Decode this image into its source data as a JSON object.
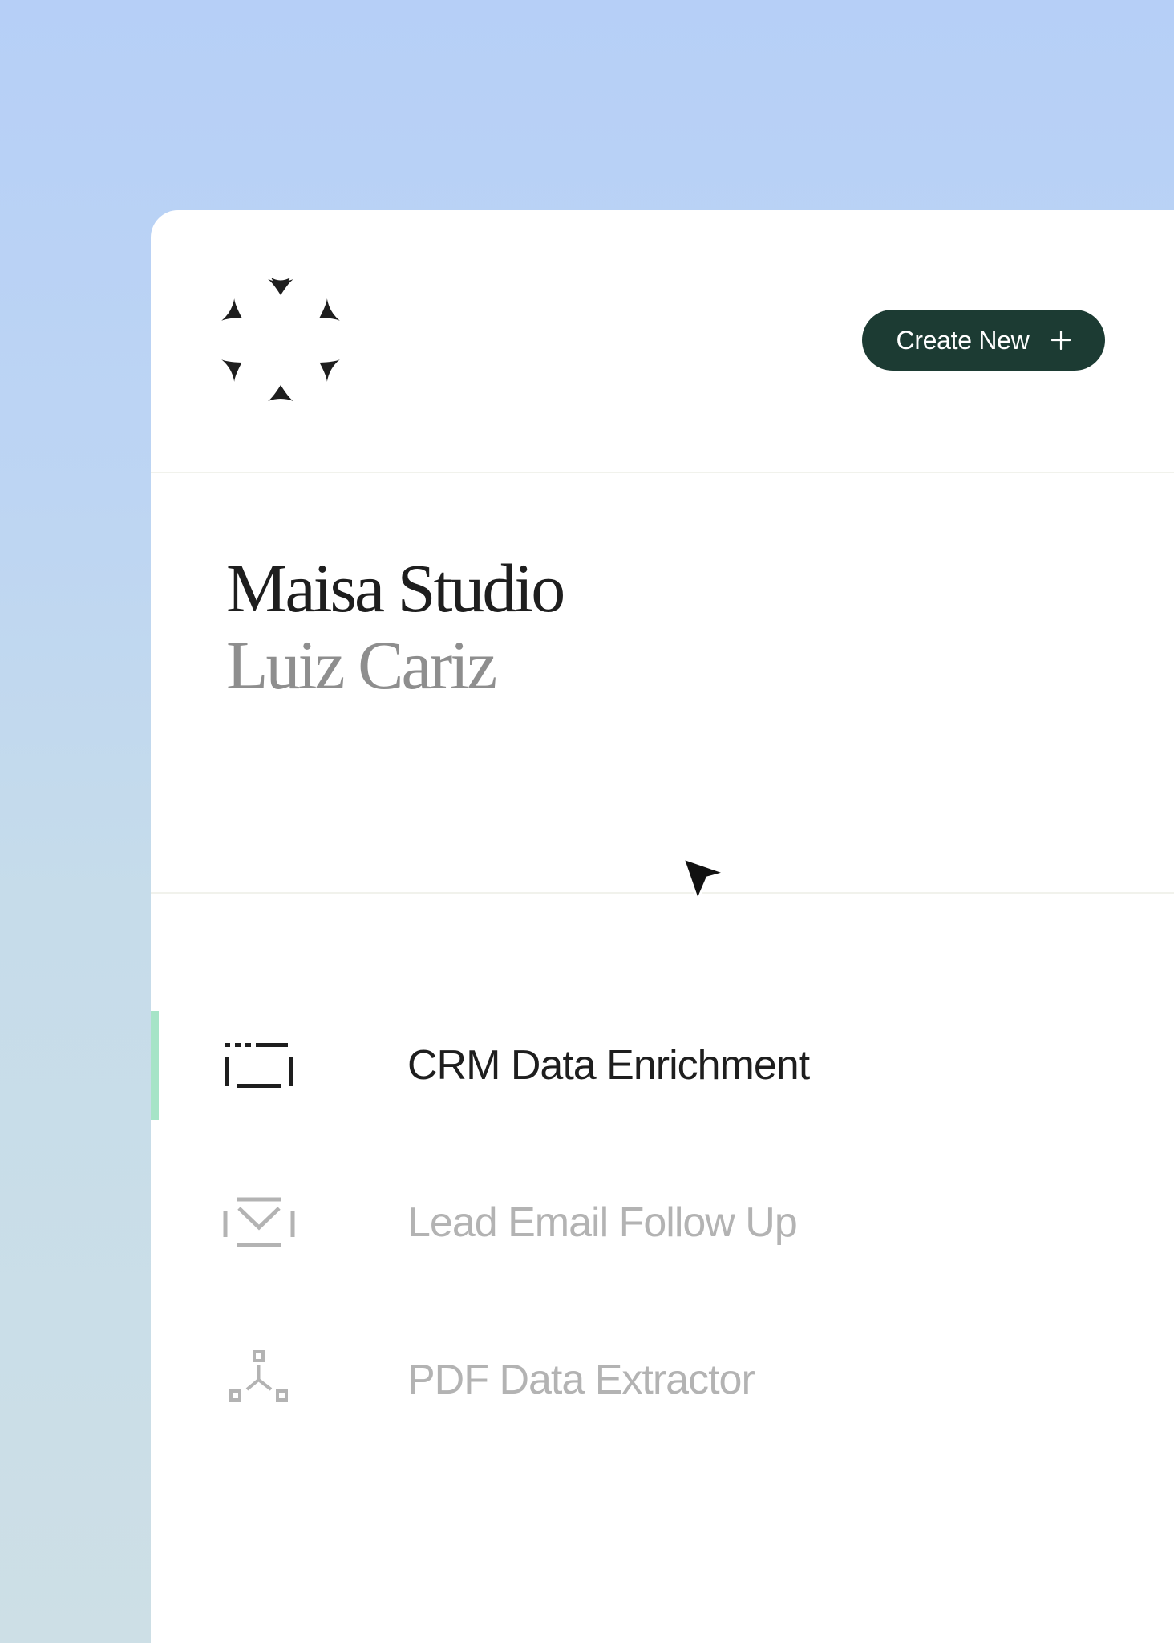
{
  "header": {
    "logo_icon": "asterisk-star-logo-icon",
    "create_button": {
      "label": "Create New",
      "icon": "plus-icon",
      "background": "#1c3b33"
    }
  },
  "identity": {
    "workspace_name": "Maisa Studio",
    "user_name": "Luiz Cariz"
  },
  "nav": {
    "items": [
      {
        "label": "CRM Data Enrichment",
        "icon": "dashed-frame-icon",
        "active": true
      },
      {
        "label": "Lead Email Follow Up",
        "icon": "envelope-check-icon",
        "active": false
      },
      {
        "label": "PDF Data Extractor",
        "icon": "node-tree-icon",
        "active": false
      }
    ],
    "active_indicator_color": "#a6e4c7"
  },
  "colors": {
    "background_top": "#b6cff7",
    "background_bottom": "#cddfe6",
    "panel": "#ffffff",
    "text_primary": "#1e1e1e",
    "text_muted": "#8e8e8e",
    "text_inactive": "#b3b3b3"
  }
}
